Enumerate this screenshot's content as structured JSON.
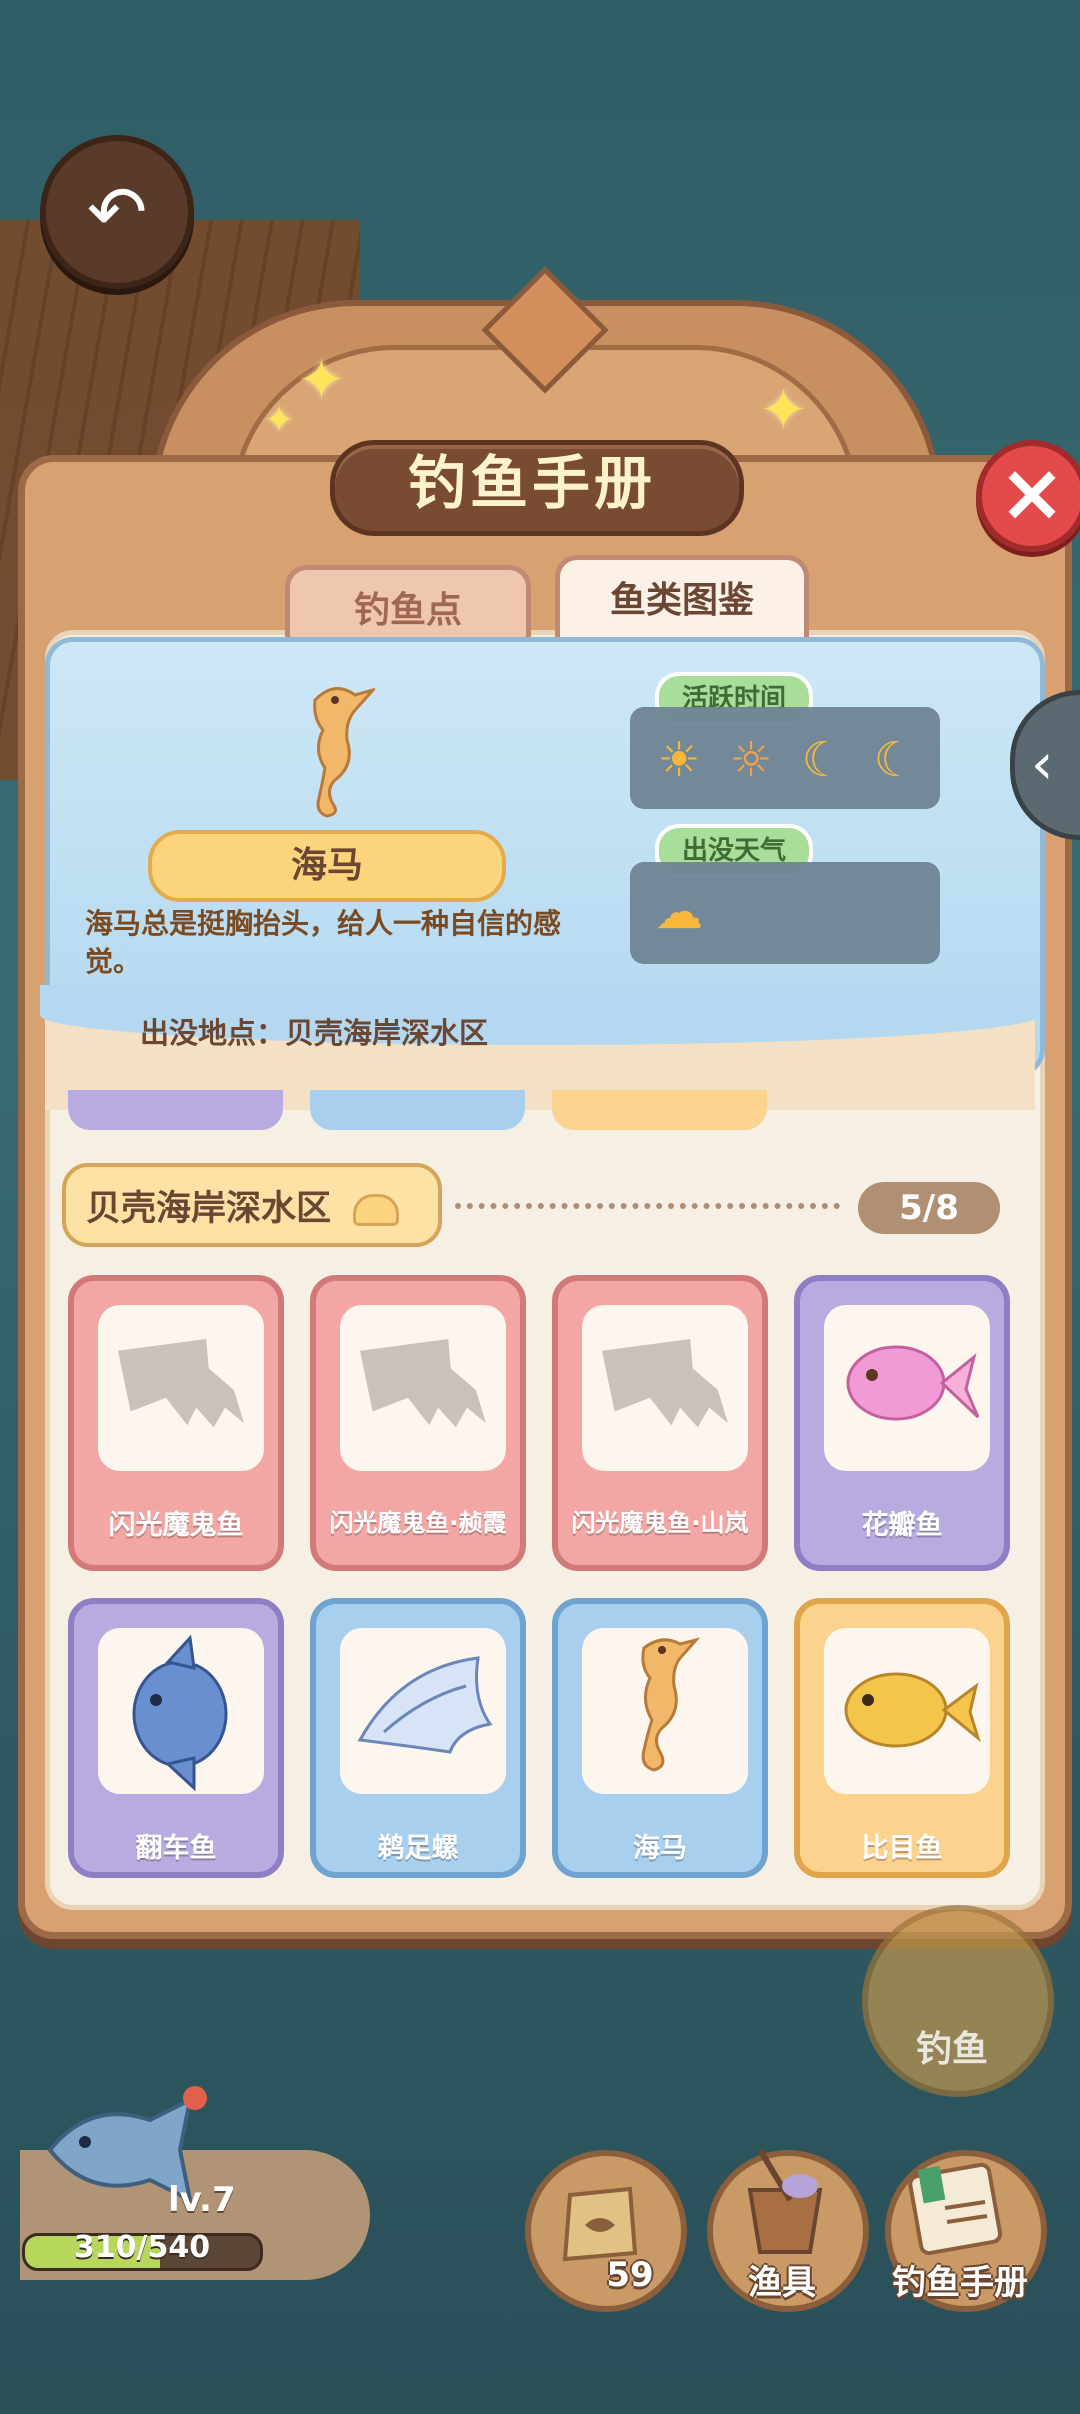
{
  "title": "钓鱼手册",
  "tabs": [
    {
      "label": "钓鱼点"
    },
    {
      "label": "鱼类图鉴"
    }
  ],
  "selected_fish": {
    "name": "海马",
    "description": "海马总是挺胸抬头，给人一种自信的感觉。",
    "location": "出没地点：贝壳海岸深水区",
    "active_time_label": "活跃时间",
    "weather_label": "出没天气",
    "active_time_icons": [
      "sun-icon",
      "sunset-icon",
      "moon-icon",
      "moon-cloud-icon"
    ],
    "weather_icons": [
      "rain-cloud-icon"
    ]
  },
  "section": {
    "name": "贝壳海岸深水区",
    "progress": "5/8"
  },
  "fish_cards": [
    {
      "label": "闪光魔鬼鱼",
      "color": "#f3a7a4",
      "discovered": false
    },
    {
      "label": "闪光魔鬼鱼·赪霞",
      "color": "#f3a7a4",
      "discovered": false
    },
    {
      "label": "闪光魔鬼鱼·山岚",
      "color": "#f3a7a4",
      "discovered": false
    },
    {
      "label": "花瓣鱼",
      "color": "#b8abe0",
      "discovered": true
    },
    {
      "label": "翻车鱼",
      "color": "#b8abe0",
      "discovered": true
    },
    {
      "label": "鹈足螺",
      "color": "#a8cfee",
      "discovered": true
    },
    {
      "label": "海马",
      "color": "#a8cfee",
      "discovered": true
    },
    {
      "label": "比目鱼",
      "color": "#fbd28e",
      "discovered": true
    }
  ],
  "bottom_bar": {
    "fishing_button": "钓鱼",
    "bait_count": "59",
    "gear_label": "渔具",
    "handbook_label": "钓鱼手册"
  },
  "player": {
    "level": "lv.7",
    "xp": "310/540",
    "xp_fraction": 0.574
  },
  "colors": {
    "accent_red": "#e54a4a",
    "panel_brown": "#d8a172",
    "chip_green": "#a9dd9a"
  }
}
